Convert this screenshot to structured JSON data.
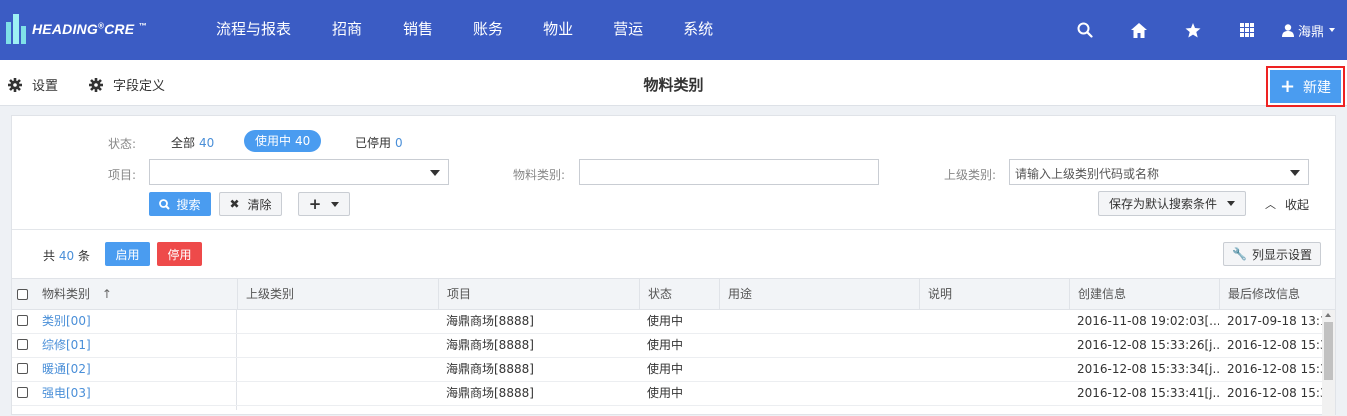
{
  "brand": {
    "name": "HEADING",
    "reg": "®",
    "suffix": "CRE",
    "tm": "™"
  },
  "nav": {
    "items": [
      "流程与报表",
      "招商",
      "销售",
      "账务",
      "物业",
      "营运",
      "系统"
    ]
  },
  "user": {
    "name": "海鼎"
  },
  "icons": {
    "search": "search-icon",
    "home": "home-icon",
    "favorites": "star-icon",
    "apps": "grid-icon",
    "user": "user-icon"
  },
  "subbar": {
    "settings": "设置",
    "field_def": "字段定义",
    "title": "物料类别",
    "new_label": "新建"
  },
  "filter": {
    "status_label": "状态:",
    "all_label": "全部",
    "all_count": "40",
    "active_label": "使用中",
    "active_count": "40",
    "disabled_label": "已停用",
    "disabled_count": "0",
    "project_label": "项目:",
    "project_value": "",
    "category_label": "物料类别:",
    "category_value": "",
    "parent_label": "上级类别:",
    "parent_placeholder": "请输入上级类别代码或名称",
    "search_btn": "搜索",
    "clear_btn": "清除",
    "add_btn": "+",
    "save_default": "保存为默认搜索条件",
    "collapse": "收起"
  },
  "toolbar": {
    "total_prefix": "共",
    "total": "40",
    "total_suffix": "条",
    "enable": "启用",
    "disable": "停用",
    "columns": "列显示设置"
  },
  "table": {
    "headers": [
      "物料类别",
      "上级类别",
      "项目",
      "状态",
      "用途",
      "说明",
      "创建信息",
      "最后修改信息"
    ],
    "rows": [
      {
        "category": "类别[00]",
        "parent": "",
        "project": "海鼎商场[8888]",
        "status": "使用中",
        "usage": "",
        "note": "",
        "created": "2016-11-08 19:02:03[...",
        "modified": "2017-09-18 13:1"
      },
      {
        "category": "综修[01]",
        "parent": "",
        "project": "海鼎商场[8888]",
        "status": "使用中",
        "usage": "",
        "note": "",
        "created": "2016-12-08 15:33:26[j...",
        "modified": "2016-12-08 15:3"
      },
      {
        "category": "暖通[02]",
        "parent": "",
        "project": "海鼎商场[8888]",
        "status": "使用中",
        "usage": "",
        "note": "",
        "created": "2016-12-08 15:33:34[j...",
        "modified": "2016-12-08 15:3"
      },
      {
        "category": "强电[03]",
        "parent": "",
        "project": "海鼎商场[8888]",
        "status": "使用中",
        "usage": "",
        "note": "",
        "created": "2016-12-08 15:33:41[j...",
        "modified": "2016-12-08 15:3"
      }
    ]
  },
  "colors": {
    "nav_bg": "#3b5cc4",
    "accent": "#4a9cf0",
    "danger": "#ee4a4a",
    "link": "#4a8fd8",
    "highlight_box": "#e22222"
  }
}
